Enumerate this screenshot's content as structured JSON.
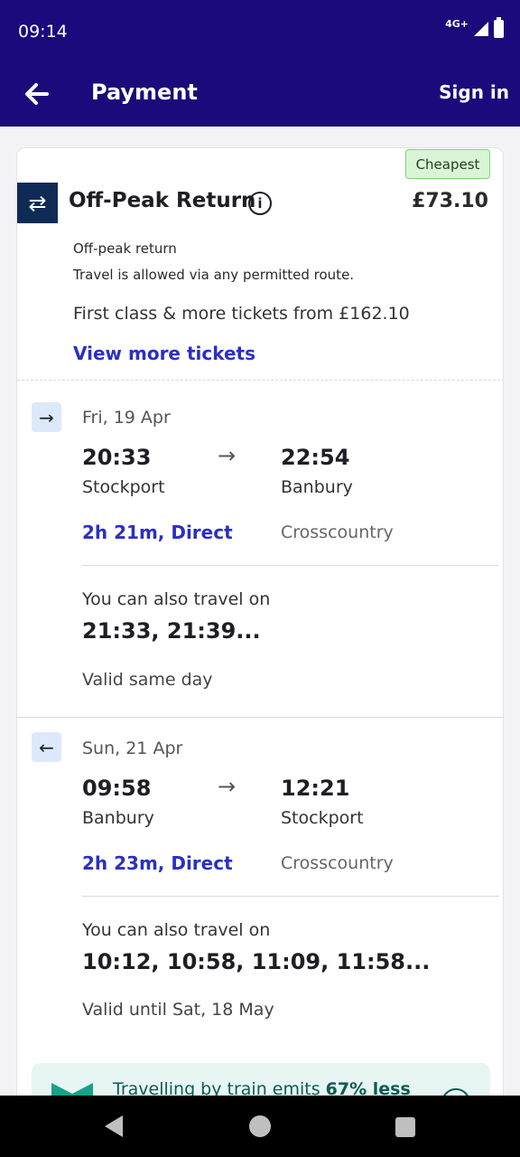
{
  "status_bar": {
    "time": "09:14",
    "network": "4G+"
  },
  "app_bar": {
    "title": "Payment",
    "sign_in_label": "Sign in"
  },
  "ticket": {
    "badge": "Cheapest",
    "name": "Off-Peak Return",
    "price": "£73.10",
    "info_symbol": "i",
    "description_line1": "Off-peak return",
    "description_line2": "Travel is allowed via any permitted route.",
    "first_class_text": "First class & more tickets from £162.10",
    "view_more_label": "View more tickets"
  },
  "outbound": {
    "direction_symbol": "→",
    "date": "Fri, 19 Apr",
    "depart_time": "20:33",
    "depart_station": "Stockport",
    "arrow": "→",
    "arrive_time": "22:54",
    "arrive_station": "Banbury",
    "duration": "2h 21m, Direct",
    "operator": "Crosscountry",
    "also_label": "You can also travel on",
    "also_times": "21:33, 21:39...",
    "validity": "Valid same day"
  },
  "return": {
    "direction_symbol": "←",
    "date": "Sun, 21 Apr",
    "depart_time": "09:58",
    "depart_station": "Banbury",
    "arrow": "→",
    "arrive_time": "12:21",
    "arrive_station": "Stockport",
    "duration": "2h 23m, Direct",
    "operator": "Crosscountry",
    "also_label": "You can also travel on",
    "also_times": "10:12, 10:58, 11:09, 11:58...",
    "validity": "Valid until Sat, 18 May"
  },
  "eco": {
    "text_prefix": "Travelling by train emits ",
    "text_highlight": "67% less"
  },
  "colors": {
    "brand": "#1b0a7c",
    "link": "#2b2fc4",
    "badge_bg": "#d8f5d6",
    "chip_bg": "#dde9fb",
    "eco_bg": "#e7f6f3",
    "eco_fg": "#0d5c54"
  }
}
